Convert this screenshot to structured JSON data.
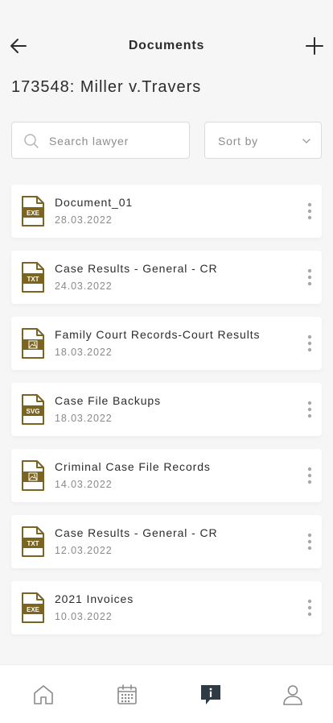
{
  "header": {
    "title": "Documents"
  },
  "case": {
    "title": "173548: Miller v.Travers"
  },
  "search": {
    "placeholder": "Search lawyer",
    "value": ""
  },
  "sort": {
    "label": "Sort by"
  },
  "documents": [
    {
      "name": "Document_01",
      "date": "28.03.2022",
      "type": "EXE"
    },
    {
      "name": "Case Results - General - CR",
      "date": "24.03.2022",
      "type": "TXT"
    },
    {
      "name": "Family Court Records-Court Results",
      "date": "18.03.2022",
      "type": "IMG"
    },
    {
      "name": "Case File Backups",
      "date": "18.03.2022",
      "type": "SVG"
    },
    {
      "name": "Criminal Case File Records",
      "date": "14.03.2022",
      "type": "IMG"
    },
    {
      "name": "Case Results - General - CR",
      "date": "12.03.2022",
      "type": "TXT"
    },
    {
      "name": "2021 Invoices",
      "date": "10.03.2022",
      "type": "EXE"
    }
  ],
  "tabbar": {
    "items": [
      {
        "icon": "home-icon",
        "active": false
      },
      {
        "icon": "calendar-icon",
        "active": false
      },
      {
        "icon": "info-chat-icon",
        "active": true
      },
      {
        "icon": "profile-icon",
        "active": false
      }
    ]
  },
  "colors": {
    "accent": "#7b6420",
    "icon_gray": "#8a8a8a",
    "background": "#f6f6f6",
    "card": "#ffffff",
    "active_tab": "#2e3a44"
  }
}
